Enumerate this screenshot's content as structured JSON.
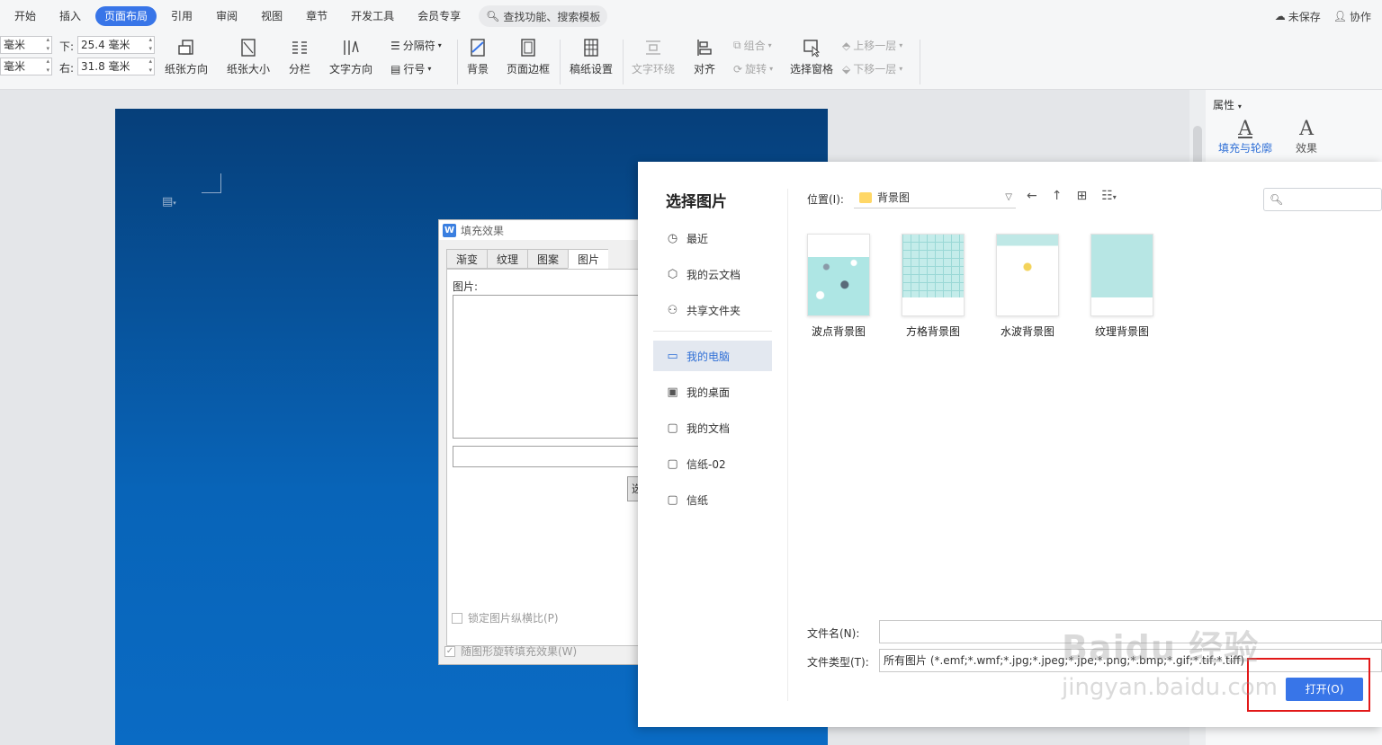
{
  "tabs": [
    "开始",
    "插入",
    "页面布局",
    "引用",
    "审阅",
    "视图",
    "章节",
    "开发工具",
    "会员专享"
  ],
  "active_tab": "页面布局",
  "search_placeholder": "查找功能、搜索模板",
  "top_right": {
    "unsaved": "未保存",
    "collab": "协作"
  },
  "ribbon": {
    "margin_unit_top": "毫米",
    "margin_unit_left": "毫米",
    "margin_bottom_label": "下:",
    "margin_bottom_value": "25.4 毫米",
    "margin_right_label": "右:",
    "margin_right_value": "31.8 毫米",
    "orientation": "纸张方向",
    "size": "纸张大小",
    "columns": "分栏",
    "text_direction": "文字方向",
    "breaks": "分隔符",
    "line_numbers": "行号",
    "background": "背景",
    "page_border": "页面边框",
    "manuscript": "稿纸设置",
    "text_wrap": "文字环绕",
    "align": "对齐",
    "group": "组合",
    "rotate": "旋转",
    "selection_pane": "选择窗格",
    "bring_forward": "上移一层",
    "send_backward": "下移一层"
  },
  "properties": {
    "title": "属性",
    "fill_outline": "填充与轮廓",
    "effects": "效果"
  },
  "fill_dialog": {
    "title": "填充效果",
    "tabs": [
      "渐变",
      "纹理",
      "图案",
      "图片"
    ],
    "active_tab": "图片",
    "picture_label": "图片:",
    "select_button": "选择图片(L)...",
    "lock_aspect": "锁定图片纵横比(P)",
    "rotate_with_shape": "随图形旋转填充效果(W)"
  },
  "picker": {
    "title": "选择图片",
    "nav": [
      "最近",
      "我的云文档",
      "共享文件夹",
      "我的电脑",
      "我的桌面",
      "我的文档",
      "信纸-02",
      "信纸"
    ],
    "active_nav": "我的电脑",
    "location_label": "位置(I):",
    "location_value": "背景图",
    "thumbnails": [
      "波点背景图",
      "方格背景图",
      "水波背景图",
      "纹理背景图"
    ],
    "filename_label": "文件名(N):",
    "filetype_label": "文件类型(T):",
    "filetype_value": "所有图片 (*.emf;*.wmf;*.jpg;*.jpeg;*.jpe;*.png;*.bmp;*.gif;*.tif;*.tiff)",
    "open_button": "打开(O)"
  },
  "watermark": {
    "logo": "Baidu经验",
    "url": "jingyan.baidu.com"
  },
  "colors": {
    "accent": "#3875e8",
    "page_top": "#063f7a",
    "page_bottom": "#0a6bc4",
    "highlight_box": "#e21818"
  }
}
